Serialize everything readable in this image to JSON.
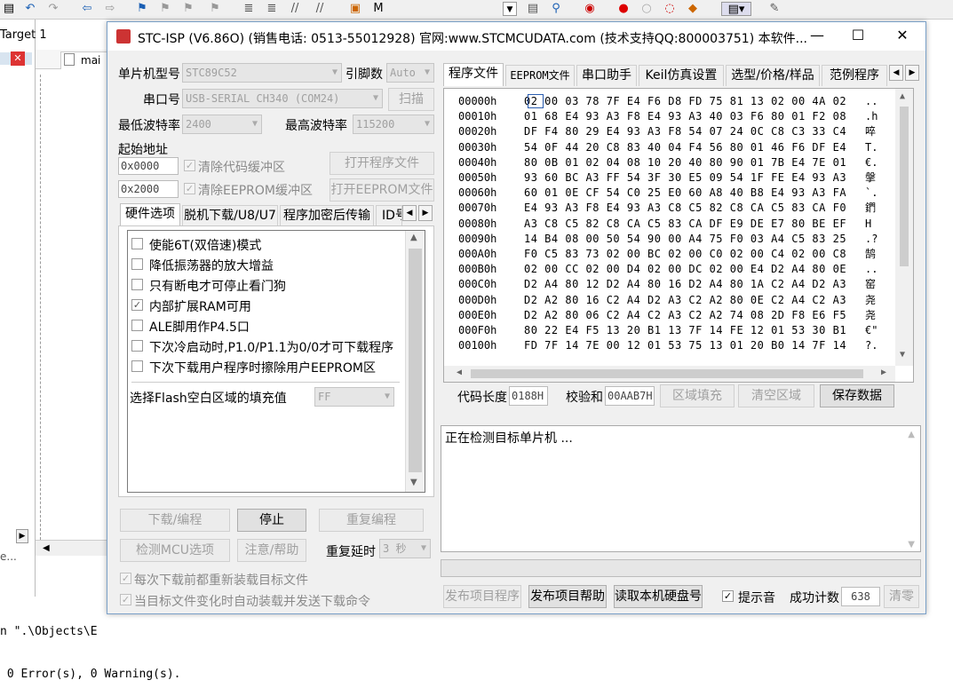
{
  "ide": {
    "target_label": "Target 1",
    "file_tab": "mai",
    "output_lines": [
      "n \".\\Objects\\E",
      " 0 Error(s), 0 Warning(s)."
    ]
  },
  "title": "STC-ISP (V6.86O) (销售电话: 0513-55012928) 官网:www.STCMCUDATA.com  (技术支持QQ:800003751) 本软件...",
  "left": {
    "mcu_type_label": "单片机型号",
    "mcu_type_value": "STC89C52",
    "pins_label": "引脚数",
    "pins_value": "Auto",
    "port_label": "串口号",
    "port_value": "USB-SERIAL CH340 (COM24)",
    "scan_button": "扫描",
    "min_baud_label": "最低波特率",
    "min_baud_value": "2400",
    "max_baud_label": "最高波特率",
    "max_baud_value": "115200",
    "start_addr_label": "起始地址",
    "addr1": "0x0000",
    "clear_code_label": "清除代码缓冲区",
    "open_prog_button": "打开程序文件",
    "addr2": "0x2000",
    "clear_eeprom_label": "清除EEPROM缓冲区",
    "open_eeprom_button": "打开EEPROM文件",
    "tabs": [
      "硬件选项",
      "脱机下载/U8/U7",
      "程序加密后传输",
      "ID号"
    ],
    "hw_options": [
      {
        "label": "使能6T(双倍速)模式",
        "checked": false
      },
      {
        "label": "降低振荡器的放大增益",
        "checked": false
      },
      {
        "label": "只有断电才可停止看门狗",
        "checked": false
      },
      {
        "label": "内部扩展RAM可用",
        "checked": true
      },
      {
        "label": "ALE脚用作P4.5口",
        "checked": false
      },
      {
        "label": "下次冷启动时,P1.0/P1.1为0/0才可下载程序",
        "checked": false
      },
      {
        "label": "下次下载用户程序时擦除用户EEPROM区",
        "checked": false
      }
    ],
    "flash_fill_label": "选择Flash空白区域的填充值",
    "flash_fill_value": "FF",
    "download_button": "下载/编程",
    "stop_button": "停止",
    "reprogram_button": "重复编程",
    "detect_button": "检测MCU选项",
    "help_button": "注意/帮助",
    "repeat_delay_label": "重复延时",
    "repeat_delay_value": "3 秒",
    "reload_label": "每次下载前都重新装载目标文件",
    "auto_send_label": "当目标文件变化时自动装载并发送下载命令"
  },
  "right": {
    "tabs": [
      "程序文件",
      "EEPROM文件",
      "串口助手",
      "Keil仿真设置",
      "选型/价格/样品",
      "范例程序"
    ],
    "hex_rows": [
      {
        "addr": "00000h",
        "bytes": "02 00 03 78 7F E4 F6 D8 FD 75 81 13 02 00 4A 02",
        "ascii": ".."
      },
      {
        "addr": "00010h",
        "bytes": "01 68 E4 93 A3 F8 E4 93 A3 40 03 F6 80 01 F2 08",
        "ascii": ".h"
      },
      {
        "addr": "00020h",
        "bytes": "DF F4 80 29 E4 93 A3 F8 54 07 24 0C C8 C3 33 C4",
        "ascii": "啐"
      },
      {
        "addr": "00030h",
        "bytes": "54 0F 44 20 C8 83 40 04 F4 56 80 01 46 F6 DF E4",
        "ascii": "T."
      },
      {
        "addr": "00040h",
        "bytes": "80 0B 01 02 04 08 10 20 40 80 90 01 7B E4 7E 01",
        "ascii": "€."
      },
      {
        "addr": "00050h",
        "bytes": "93 60 BC A3 FF 54 3F 30 E5 09 54 1F FE E4 93 A3",
        "ascii": "搫"
      },
      {
        "addr": "00060h",
        "bytes": "60 01 0E CF 54 C0 25 E0 60 A8 40 B8 E4 93 A3 FA",
        "ascii": "`."
      },
      {
        "addr": "00070h",
        "bytes": "E4 93 A3 F8 E4 93 A3 C8 C5 82 C8 CA C5 83 CA F0",
        "ascii": "鍆"
      },
      {
        "addr": "00080h",
        "bytes": "A3 C8 C5 82 C8 CA C5 83 CA DF E9 DE E7 80 BE EF",
        "ascii": "H"
      },
      {
        "addr": "00090h",
        "bytes": "14 B4 08 00 50 54 90 00 A4 75 F0 03 A4 C5 83 25",
        "ascii": ".?"
      },
      {
        "addr": "000A0h",
        "bytes": "F0 C5 83 73 02 00 BC 02 00 C0 02 00 C4 02 00 C8",
        "ascii": "鹄"
      },
      {
        "addr": "000B0h",
        "bytes": "02 00 CC 02 00 D4 02 00 DC 02 00 E4 D2 A4 80 0E",
        "ascii": ".."
      },
      {
        "addr": "000C0h",
        "bytes": "D2 A4 80 12 D2 A4 80 16 D2 A4 80 1A C2 A4 D2 A3",
        "ascii": "窑"
      },
      {
        "addr": "000D0h",
        "bytes": "D2 A2 80 16 C2 A4 D2 A3 C2 A2 80 0E C2 A4 C2 A3",
        "ascii": "尧"
      },
      {
        "addr": "000E0h",
        "bytes": "D2 A2 80 06 C2 A4 C2 A3 C2 A2 74 08 2D F8 E6 F5",
        "ascii": "尧"
      },
      {
        "addr": "000F0h",
        "bytes": "80 22 E4 F5 13 20 B1 13 7F 14 FE 12 01 53 30 B1",
        "ascii": "€\""
      },
      {
        "addr": "00100h",
        "bytes": "FD 7F 14 7E 00 12 01 53 75 13 01 20 B0 14 7F 14",
        "ascii": "?."
      }
    ],
    "code_len_label": "代码长度",
    "code_len_value": "0188H",
    "checksum_label": "校验和",
    "checksum_value": "00AAB7H",
    "fill_button": "区域填充",
    "clear_button": "清空区域",
    "save_button": "保存数据",
    "status_text": "正在检测目标单片机 ...",
    "publish_prog_button": "发布项目程序",
    "publish_help_button": "发布项目帮助",
    "read_disk_button": "读取本机硬盘号",
    "sound_label": "提示音",
    "success_label": "成功计数",
    "success_value": "638",
    "clear_count_button": "清零"
  }
}
